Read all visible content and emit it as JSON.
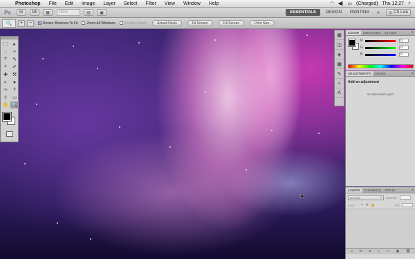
{
  "menubar": {
    "apple": "",
    "items": [
      "Photoshop",
      "File",
      "Edit",
      "Image",
      "Layer",
      "Select",
      "Filter",
      "View",
      "Window",
      "Help"
    ],
    "status_icons": [
      "wifi-icon",
      "volume-icon"
    ],
    "battery": "(Charged)",
    "clock": "Thu 12:27",
    "search_icon": "⌕"
  },
  "appbar": {
    "logo": "Ps",
    "zoom_value": "100%",
    "workspaces": [
      "ESSENTIALS",
      "DESIGN",
      "PAINTING"
    ],
    "more": "»",
    "cslive": "CS Live"
  },
  "optionsbar": {
    "resize_windows": "Resize Windows To Fit",
    "zoom_all_windows": "Zoom All Windows",
    "scrubby_zoom": "Scrubby Zoom",
    "buttons": [
      "Actual Pixels",
      "Fit Screen",
      "Fill Screen",
      "Print Size"
    ]
  },
  "tools": [
    "⬚",
    "▸",
    "◌",
    "✧",
    "⌗",
    "✎",
    "⌖",
    "✐",
    "✚",
    "⚒",
    "◐",
    "●",
    "✑",
    "T",
    "◊",
    "▭",
    "✋",
    "🔍"
  ],
  "color_panel": {
    "tabs": [
      "COLOR",
      "SWATCHES",
      "STYLES"
    ],
    "sliders": [
      {
        "label": "R",
        "value": "0"
      },
      {
        "label": "G",
        "value": "0"
      },
      {
        "label": "B",
        "value": "0"
      }
    ]
  },
  "adjustments_panel": {
    "tabs": [
      "ADJUSTMENTS",
      "MASKS"
    ],
    "title": "Add an adjustment",
    "message": "No document open"
  },
  "layers_panel": {
    "tabs": [
      "LAYERS",
      "CHANNELS",
      "PATHS"
    ],
    "blend_mode": "Normal",
    "opacity_label": "Opacity:",
    "lock_label": "Lock:",
    "fill_label": "Fill:",
    "footer_icons": [
      "∞",
      "fx",
      "◘",
      "◑",
      "▭",
      "▣",
      "🗑"
    ]
  }
}
